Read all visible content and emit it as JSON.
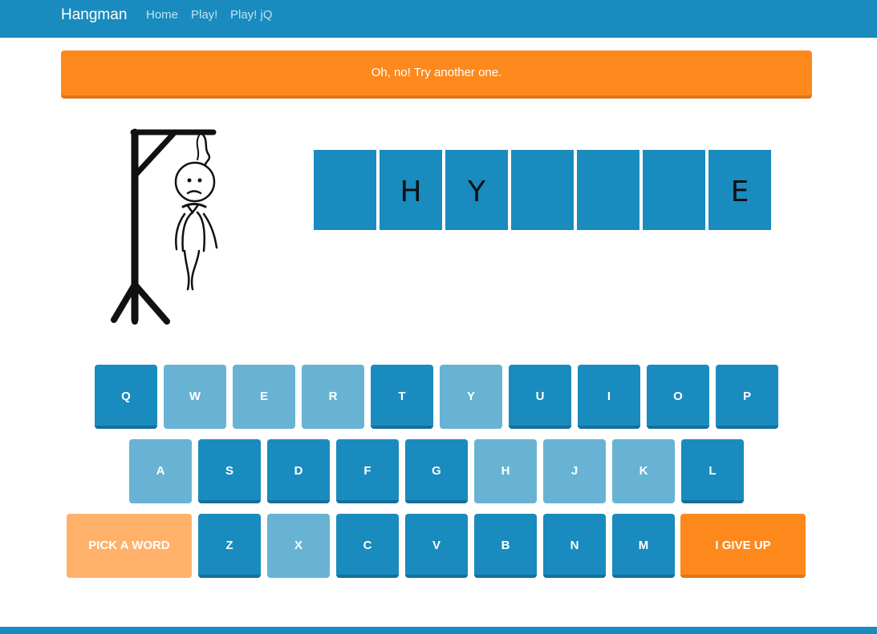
{
  "navbar": {
    "brand": "Hangman",
    "links": [
      "Home",
      "Play!",
      "Play! jQ"
    ]
  },
  "alert": {
    "message": "Oh, no! Try another one."
  },
  "word_slots": [
    "",
    "H",
    "Y",
    "",
    "",
    "",
    "E"
  ],
  "keyboard": {
    "row1": [
      {
        "label": "Q",
        "state": "active"
      },
      {
        "label": "W",
        "state": "used"
      },
      {
        "label": "E",
        "state": "used"
      },
      {
        "label": "R",
        "state": "used"
      },
      {
        "label": "T",
        "state": "active"
      },
      {
        "label": "Y",
        "state": "used"
      },
      {
        "label": "U",
        "state": "active"
      },
      {
        "label": "I",
        "state": "active"
      },
      {
        "label": "O",
        "state": "active"
      },
      {
        "label": "P",
        "state": "active"
      }
    ],
    "row2": [
      {
        "label": "A",
        "state": "used"
      },
      {
        "label": "S",
        "state": "active"
      },
      {
        "label": "D",
        "state": "active"
      },
      {
        "label": "F",
        "state": "active"
      },
      {
        "label": "G",
        "state": "active"
      },
      {
        "label": "H",
        "state": "used"
      },
      {
        "label": "J",
        "state": "used"
      },
      {
        "label": "K",
        "state": "used"
      },
      {
        "label": "L",
        "state": "active"
      }
    ],
    "row3": [
      {
        "label": "Z",
        "state": "active"
      },
      {
        "label": "X",
        "state": "used"
      },
      {
        "label": "C",
        "state": "active"
      },
      {
        "label": "V",
        "state": "active"
      },
      {
        "label": "B",
        "state": "active"
      },
      {
        "label": "N",
        "state": "active"
      },
      {
        "label": "M",
        "state": "active"
      }
    ],
    "pick_label": "PICK A WORD",
    "giveup_label": "I GIVE UP"
  },
  "colors": {
    "primary": "#1a8bbe",
    "primary_used": "#68b3d3",
    "warning": "#fd891d",
    "warning_light": "#ffb16a"
  },
  "icons": {
    "hangman": "hangman-figure-icon"
  }
}
